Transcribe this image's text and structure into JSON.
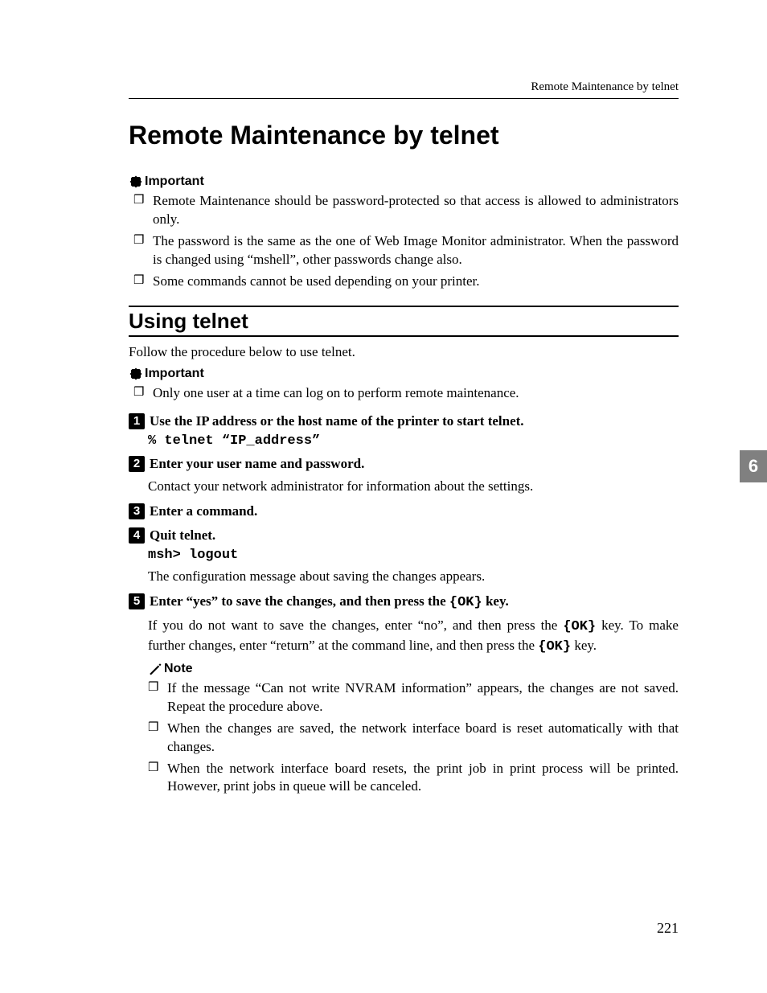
{
  "running_head": "Remote Maintenance by telnet",
  "chapter_tab": "6",
  "page_number": "221",
  "title": "Remote Maintenance by telnet",
  "important_label": "Important",
  "note_label": "Note",
  "intro_important": [
    "Remote Maintenance should be password-protected so that access is allowed to administrators only.",
    "The password is the same as the one of Web Image Monitor administrator. When the password is changed using “mshell”, other passwords change also.",
    "Some commands cannot be used depending on your printer."
  ],
  "section1_title": "Using telnet",
  "section1_intro": "Follow the procedure below to use telnet.",
  "section1_important": [
    "Only one user at a time can log on to perform remote maintenance."
  ],
  "steps": {
    "s1_text": "Use the IP address or the host name of the printer to start telnet.",
    "s1_cmd": "% telnet “IP_address”",
    "s2_text": "Enter your user name and password.",
    "s2_body": "Contact your network administrator for information about the settings.",
    "s3_text": "Enter a command.",
    "s4_text": "Quit telnet.",
    "s4_cmd": "msh> logout",
    "s4_body": "The configuration message about saving the changes appears.",
    "s5_pre": "Enter “yes” to save the changes, and then press the ",
    "s5_key": "{OK}",
    "s5_post": " key.",
    "s5_body_pre": "If you do not want to save the changes, enter “no”, and then press the ",
    "s5_body_mid": " key. To make further changes, enter “return” at the command line, and then press the ",
    "s5_body_post": " key."
  },
  "notes": [
    "If the message “Can not write NVRAM information” appears, the changes are not saved. Repeat the procedure above.",
    "When the changes are saved, the network interface board is reset automatically with that changes.",
    "When the network interface board resets, the print job in print process will be printed. However, print jobs in queue will be canceled."
  ]
}
